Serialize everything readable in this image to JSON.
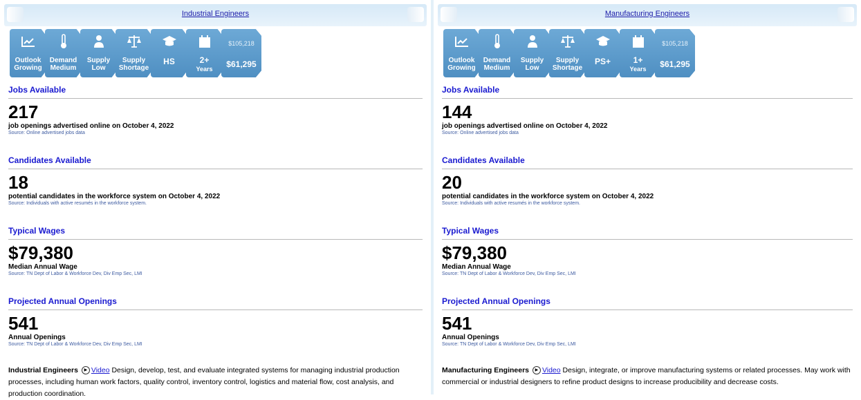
{
  "left": {
    "title": "Industrial Engineers",
    "tiles": {
      "outlook": {
        "icon": "trending-up-icon",
        "line1": "Outlook",
        "line2": "Growing"
      },
      "demand": {
        "icon": "thermometer-icon",
        "line1": "Demand",
        "line2": "Medium"
      },
      "supply": {
        "icon": "people-icon",
        "line1": "Supply",
        "line2": "Low"
      },
      "shortage": {
        "icon": "scales-icon",
        "line1": "Supply",
        "line2": "Shortage"
      },
      "education": {
        "icon": "graduation-cap-icon",
        "label": "HS"
      },
      "experience": {
        "icon": "calendar-icon",
        "label": "2+",
        "sub": "Years"
      },
      "wages": {
        "high": "$105,218",
        "low": "$61,295"
      }
    },
    "jobs": {
      "title": "Jobs Available",
      "value": "217",
      "desc": "job openings advertised online on October 4, 2022",
      "source": "Source: Online advertised jobs data"
    },
    "candidates": {
      "title": "Candidates Available",
      "value": "18",
      "desc": "potential candidates in the workforce system on October 4, 2022",
      "source": "Source: Individuals with active resumés in the workforce system."
    },
    "wages": {
      "title": "Typical Wages",
      "value": "$79,380",
      "desc": "Median Annual Wage",
      "source": "Source: TN Dept of Labor & Workforce Dev, Div Emp Sec, LMI"
    },
    "openings": {
      "title": "Projected Annual Openings",
      "value": "541",
      "desc": "Annual Openings",
      "source": "Source: TN Dept of Labor & Workforce Dev, Div Emp Sec, LMI"
    },
    "blurb": {
      "name": "Industrial Engineers",
      "video": "Video",
      "text": " Design, develop, test, and evaluate integrated systems for managing industrial production processes, including human work factors, quality control, inventory control, logistics and material flow, cost analysis, and production coordination."
    }
  },
  "right": {
    "title": "Manufacturing Engineers",
    "tiles": {
      "outlook": {
        "icon": "trending-up-icon",
        "line1": "Outlook",
        "line2": "Growing"
      },
      "demand": {
        "icon": "thermometer-icon",
        "line1": "Demand",
        "line2": "Medium"
      },
      "supply": {
        "icon": "people-icon",
        "line1": "Supply",
        "line2": "Low"
      },
      "shortage": {
        "icon": "scales-icon",
        "line1": "Supply",
        "line2": "Shortage"
      },
      "education": {
        "icon": "graduation-cap-icon",
        "label": "PS+"
      },
      "experience": {
        "icon": "calendar-icon",
        "label": "1+",
        "sub": "Years"
      },
      "wages": {
        "high": "$105,218",
        "low": "$61,295"
      }
    },
    "jobs": {
      "title": "Jobs Available",
      "value": "144",
      "desc": "job openings advertised online on October 4, 2022",
      "source": "Source: Online advertised jobs data"
    },
    "candidates": {
      "title": "Candidates Available",
      "value": "20",
      "desc": "potential candidates in the workforce system on October 4, 2022",
      "source": "Source: Individuals with active resumés in the workforce system."
    },
    "wages": {
      "title": "Typical Wages",
      "value": "$79,380",
      "desc": "Median Annual Wage",
      "source": "Source: TN Dept of Labor & Workforce Dev, Div Emp Sec, LMI"
    },
    "openings": {
      "title": "Projected Annual Openings",
      "value": "541",
      "desc": "Annual Openings",
      "source": "Source: TN Dept of Labor & Workforce Dev, Div Emp Sec, LMI"
    },
    "blurb": {
      "name": "Manufacturing Engineers",
      "video": "Video",
      "text": " Design, integrate, or improve manufacturing systems or related processes. May work with commercial or industrial designers to refine product designs to increase producibility and decrease costs."
    }
  }
}
